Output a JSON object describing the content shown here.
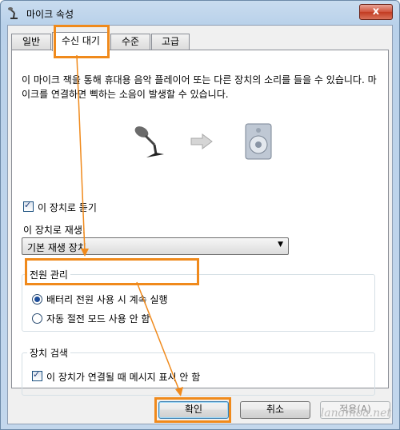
{
  "window": {
    "title": "마이크 속성",
    "close_symbol": "x"
  },
  "tabs": [
    {
      "label": "일반"
    },
    {
      "label": "수신 대기"
    },
    {
      "label": "수준"
    },
    {
      "label": "고급"
    }
  ],
  "description": "이 마이크 잭을 통해 휴대용 음악 플레이어 또는 다른 장치의 소리를 들을 수 있습니다. 마이크를 연결하면 삑하는 소음이 발생할 수 있습니다.",
  "icons": {
    "mic": "microphone-icon",
    "arrow": "right-arrow-icon",
    "speaker": "speaker-icon"
  },
  "listen": {
    "label": "이 장치로 듣기",
    "checked": true
  },
  "playback": {
    "label": "이 장치로 재생:",
    "selected": "기본 재생 장치"
  },
  "power": {
    "title": "전원 관리",
    "option1": "배터리 전원 사용 시 계속 실행",
    "option2": "자동 절전 모드 사용 안 함",
    "selected": "option1"
  },
  "detection": {
    "title": "장치 검색",
    "label": "이 장치가 연결될 때 메시지 표시 안 함",
    "checked": true
  },
  "buttons": {
    "ok": "확인",
    "cancel": "취소",
    "apply": "적용(A)"
  },
  "watermark": "landmoa.net",
  "colors": {
    "highlight": "#f08a1c",
    "titlebar": "#b9d1ea",
    "close": "#c23b21"
  }
}
